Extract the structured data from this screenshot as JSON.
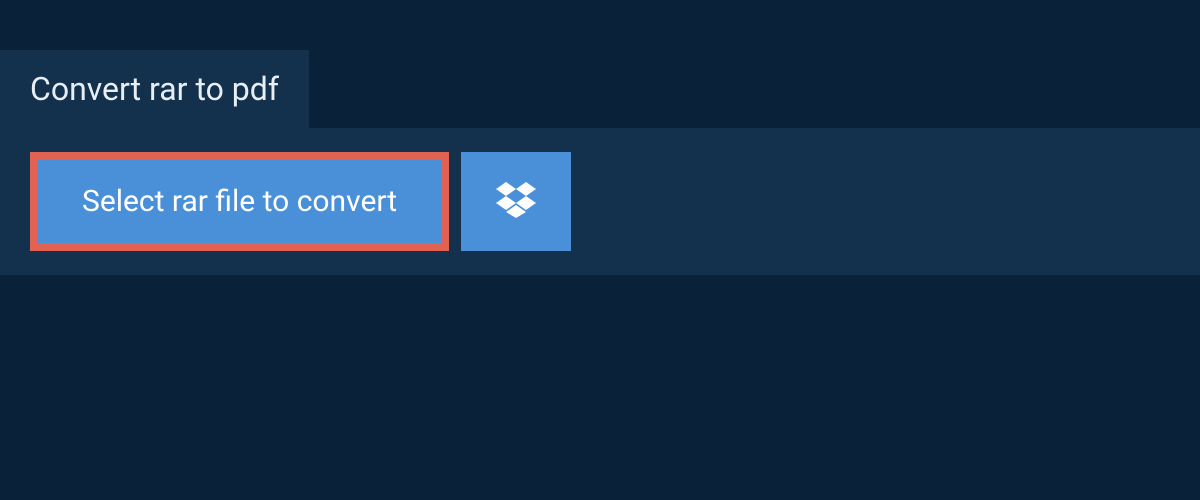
{
  "tab": {
    "title": "Convert rar to pdf"
  },
  "actions": {
    "select_label": "Select rar file to convert"
  },
  "colors": {
    "background": "#0a2239",
    "panel": "#13304d",
    "button": "#4a90d9",
    "highlight_border": "#e16152",
    "text_light": "#e8eef5",
    "text_white": "#ffffff"
  }
}
